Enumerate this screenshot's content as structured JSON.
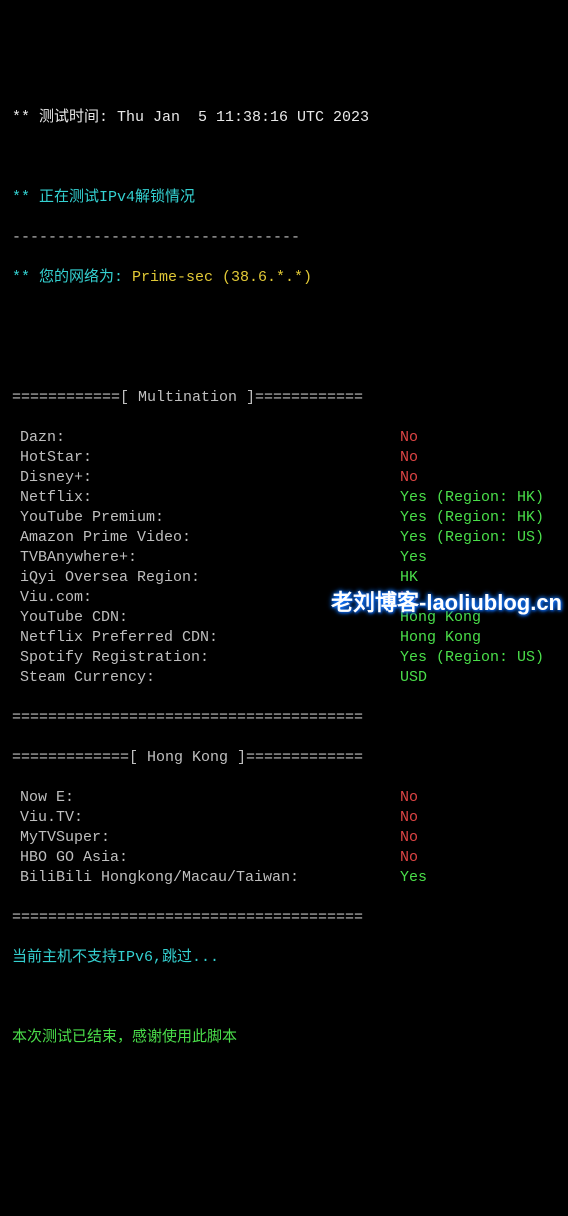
{
  "header": {
    "time_prefix": "** 测试时间: ",
    "time_value": "Thu Jan  5 11:38:16 UTC 2023",
    "ipv4_line": "** 正在测试IPv4解锁情况",
    "dashes": "--------------------------------",
    "net_prefix": "** 您的网络为: ",
    "net_value": "Prime-sec (38.6.*.*)"
  },
  "section1": {
    "title": "============[ Multination ]============",
    "items": [
      {
        "label": "Dazn:",
        "value": "No",
        "cls": "red"
      },
      {
        "label": "HotStar:",
        "value": "No",
        "cls": "red"
      },
      {
        "label": "Disney+:",
        "value": "No",
        "cls": "red"
      },
      {
        "label": "Netflix:",
        "value": "Yes (Region: HK)",
        "cls": "green"
      },
      {
        "label": "YouTube Premium:",
        "value": "Yes (Region: HK)",
        "cls": "green"
      },
      {
        "label": "Amazon Prime Video:",
        "value": "Yes (Region: US)",
        "cls": "green"
      },
      {
        "label": "TVBAnywhere+:",
        "value": "Yes",
        "cls": "green"
      },
      {
        "label": "iQyi Oversea Region:",
        "value": "HK",
        "cls": "green"
      },
      {
        "label": "Viu.com:",
        "value": "No",
        "cls": "red"
      },
      {
        "label": "YouTube CDN:",
        "value": "Hong Kong",
        "cls": "green"
      },
      {
        "label": "Netflix Preferred CDN:",
        "value": "Hong Kong",
        "cls": "green"
      },
      {
        "label": "Spotify Registration:",
        "value": "Yes (Region: US)",
        "cls": "green"
      },
      {
        "label": "Steam Currency:",
        "value": "USD",
        "cls": "green"
      }
    ],
    "footer": "======================================="
  },
  "section2": {
    "title": "=============[ Hong Kong ]=============",
    "items": [
      {
        "label": "Now E:",
        "value": "No",
        "cls": "red"
      },
      {
        "label": "Viu.TV:",
        "value": "No",
        "cls": "red"
      },
      {
        "label": "MyTVSuper:",
        "value": "No",
        "cls": "red"
      },
      {
        "label": "HBO GO Asia:",
        "value": "No",
        "cls": "red"
      },
      {
        "label": "BiliBili Hongkong/Macau/Taiwan:",
        "value": "Yes",
        "cls": "green"
      }
    ],
    "footer": "======================================="
  },
  "footer": {
    "ipv6_line": "当前主机不支持IPv6,跳过...",
    "end_line": "本次测试已结束，感谢使用此脚本"
  },
  "watermark": "老刘博客-laoliublog.cn"
}
